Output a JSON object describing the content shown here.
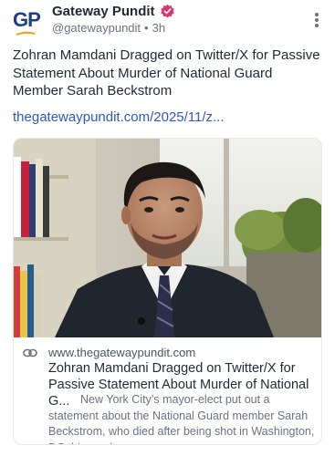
{
  "account": {
    "logo_text": "GP",
    "display_name": "Gateway Pundit",
    "handle": "@gatewaypundit",
    "separator": "•",
    "timestamp": "3h",
    "verified_color": "#e0336e",
    "icons": {
      "verified": "verified-badge-icon",
      "menu": "more-vertical-icon"
    }
  },
  "post": {
    "text": "Zohran Mamdani Dragged on Twitter/X for Passive Statement About Murder of National Guard Member Sarah Beckstrom",
    "link_text": "thegatewaypundit.com/2025/11/z..."
  },
  "card": {
    "domain": "www.thegatewaypundit.com",
    "title": "Zohran Mamdani Dragged on Twitter/X for Passive Statement About Murder of National G...",
    "description": "New York City’s mayor-elect put out a statement about the National Guard member Sarah Beckstrom, who died after being shot in Washington, DC this week.",
    "icon": "link-icon"
  },
  "colors": {
    "link": "#2f56c4",
    "brand_blue": "#1e3f8a",
    "brand_orange": "#f59e0b"
  }
}
